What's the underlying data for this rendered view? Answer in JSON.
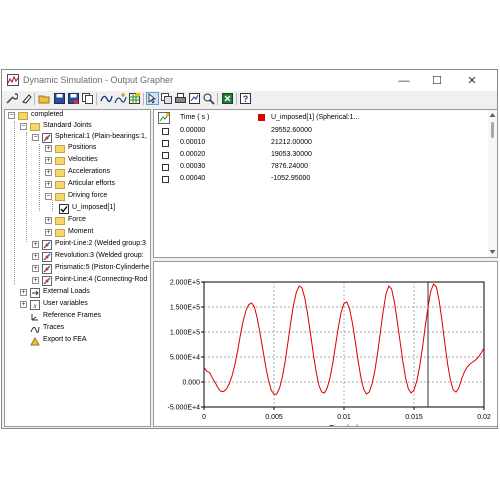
{
  "window": {
    "title": "Dynamic Simulation - Output Grapher",
    "minimize_glyph": "—",
    "maximize_glyph": "☐",
    "close_glyph": "✕"
  },
  "toolbar": {
    "icons": [
      "wrench-icon",
      "eraser-icon",
      "open-folder-icon",
      "save-icon",
      "save-as-icon",
      "copy-icon",
      "curve-icon",
      "curve-add-icon",
      "grid-icon",
      "select-icon",
      "copy-chart-icon",
      "print-icon",
      "export-icon",
      "zoom-icon",
      "excel-icon",
      "help-icon"
    ]
  },
  "tree": {
    "root": "completed",
    "standard_joints": "Standard Joints",
    "spherical": "Spherical:1 (Plain-bearings:1,",
    "positions": "Positions",
    "velocities": "Velocities",
    "accelerations": "Accelerations",
    "articular_efforts": "Articular efforts",
    "driving_force": "Driving force",
    "u_imposed": "U_imposed[1]",
    "force": "Force",
    "moment": "Moment",
    "point_line_2": "Point-Line:2 (Welded group:3",
    "revolution_3": "Revolution:3 (Welded group:",
    "prismatic_5": "Prismatic:5 (Piston-Cylinderhe",
    "point_line_4": "Point-Line:4 (Connecting-Rod",
    "external_loads": "External Loads",
    "user_variables": "User variables",
    "reference_frames": "Reference Frames",
    "traces": "Traces",
    "export_fea": "Export to FEA"
  },
  "table": {
    "col_time": "Time ( s )",
    "col_series": "U_imposed[1] (Spherical:1...",
    "series_color": "#e00000",
    "rows": [
      {
        "time": "0.00000",
        "value": "29552.60000"
      },
      {
        "time": "0.00010",
        "value": "21212.00000"
      },
      {
        "time": "0.00020",
        "value": "19053.30000"
      },
      {
        "time": "0.00030",
        "value": "7876.24000"
      },
      {
        "time": "0.00040",
        "value": "-1052.95000"
      }
    ]
  },
  "chart_data": {
    "type": "line",
    "xlabel": "Time ( s )",
    "ylabel": "",
    "xlim": [
      0,
      0.02
    ],
    "ylim": [
      -50000,
      200000
    ],
    "x_ticks": [
      "0",
      "0.005",
      "0.01",
      "0.015",
      "0.02"
    ],
    "y_ticks": [
      "2.000E+5",
      "1.500E+5",
      "1.000E+5",
      "5.000E+4",
      "0.000",
      "-5.000E+4"
    ],
    "grid": true,
    "cursor_x": 0.016,
    "line_color": "#e00000",
    "series": [
      {
        "x": [
          0,
          0.0002,
          0.0004,
          0.0006,
          0.0008,
          0.001,
          0.0012,
          0.0014,
          0.0016,
          0.0018,
          0.002,
          0.0022,
          0.0024,
          0.0026,
          0.0028,
          0.003,
          0.0032,
          0.0034,
          0.0036,
          0.0038,
          0.004,
          0.0042,
          0.0044,
          0.0046,
          0.0048,
          0.005,
          0.0052,
          0.0054,
          0.0056,
          0.0058,
          0.006,
          0.0062,
          0.0064,
          0.0066,
          0.0068,
          0.007,
          0.0072,
          0.0074,
          0.0076,
          0.0078,
          0.008,
          0.0082,
          0.0084,
          0.0086,
          0.0088,
          0.009,
          0.0092,
          0.0094,
          0.0096,
          0.0098,
          0.01,
          0.0102,
          0.0104,
          0.0106,
          0.0108,
          0.011,
          0.0112,
          0.0114,
          0.0116,
          0.0118,
          0.012,
          0.0122,
          0.0124,
          0.0126,
          0.0128,
          0.013,
          0.0132,
          0.0134,
          0.0136,
          0.0138,
          0.014,
          0.0142,
          0.0144,
          0.0146,
          0.0148,
          0.015,
          0.0152,
          0.0154,
          0.0156,
          0.0158,
          0.016,
          0.0162,
          0.0164,
          0.0166,
          0.0168,
          0.017,
          0.0172,
          0.0174,
          0.0176,
          0.0178,
          0.018,
          0.0182,
          0.0184,
          0.0186,
          0.0188,
          0.019,
          0.0192,
          0.0194,
          0.0196,
          0.0198,
          0.02
        ],
        "y": [
          29550,
          21210,
          19050,
          7880,
          -1050,
          -12000,
          -18500,
          -19000,
          -14000,
          -4000,
          12000,
          34000,
          62000,
          94000,
          122000,
          143000,
          155000,
          158000,
          150000,
          128000,
          98000,
          65000,
          32000,
          4000,
          -16000,
          -25000,
          -24000,
          -12000,
          10000,
          42000,
          80000,
          120000,
          155000,
          180000,
          192000,
          188000,
          168000,
          136000,
          98000,
          58000,
          22000,
          -6000,
          -20000,
          -22000,
          -12000,
          8000,
          38000,
          74000,
          110000,
          140000,
          157000,
          160000,
          146000,
          118000,
          82000,
          44000,
          10000,
          -14000,
          -24000,
          -20000,
          -4000,
          22000,
          58000,
          100000,
          142000,
          176000,
          192000,
          186000,
          160000,
          122000,
          82000,
          42000,
          8000,
          -14000,
          -22000,
          -16000,
          2000,
          30000,
          68000,
          110000,
          150000,
          182000,
          196000,
          190000,
          162000,
          122000,
          78000,
          36000,
          4000,
          -16000,
          -20000,
          -12000,
          6000,
          20000,
          30000,
          36000,
          40000,
          44000,
          50000,
          58000,
          68000
        ]
      }
    ]
  }
}
